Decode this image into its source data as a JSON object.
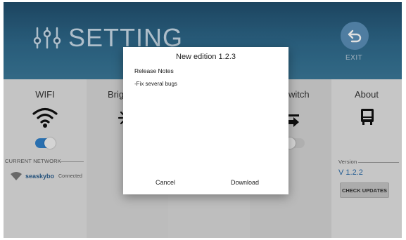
{
  "header": {
    "title": "SETTING",
    "exit_label": "EXIT"
  },
  "panels": {
    "wifi": {
      "title": "WIFI",
      "toggle_state": "on",
      "current_network_label": "CURRENT NETWORK",
      "network_name": "seaskybo",
      "network_status": "Connected"
    },
    "brightness": {
      "title": "Brig"
    },
    "switch": {
      "title": "witch",
      "toggle_state": "off"
    },
    "about": {
      "title": "About",
      "version_label": "Version",
      "version_value": "V 1.2.2",
      "check_updates_label": "CHECK UPDATES"
    }
  },
  "dialog": {
    "title": "New edition 1.2.3",
    "notes_label": "Release Notes",
    "notes": [
      "-Fix several bugs"
    ],
    "cancel_label": "Cancel",
    "download_label": "Download"
  },
  "colors": {
    "header_bg": "#2f6a8c",
    "accent_blue": "#2f7fc8",
    "exit_button": "#5a8fb8"
  },
  "icons": [
    "sliders-icon",
    "exit-back-arrow-icon",
    "wifi-icon",
    "sun-icon",
    "switch-arrow-icon",
    "device-icon",
    "wifi-small-icon"
  ]
}
